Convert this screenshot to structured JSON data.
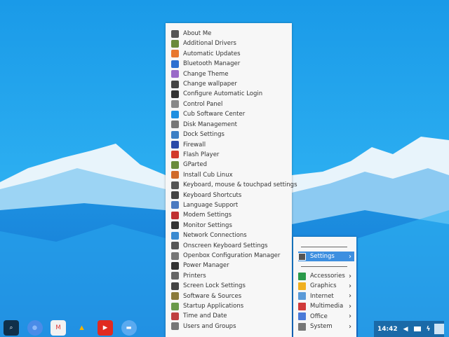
{
  "colors": {
    "accent": "#3d8fe0",
    "sky": "#2aa8f0"
  },
  "menu": {
    "items": [
      {
        "label": "About Me",
        "color": "#555"
      },
      {
        "label": "Additional Drivers",
        "color": "#6a8a3a"
      },
      {
        "label": "Automatic Updates",
        "color": "#e8772e"
      },
      {
        "label": "Bluetooth Manager",
        "color": "#2c6fd0"
      },
      {
        "label": "Change Theme",
        "color": "#9a6ac8"
      },
      {
        "label": "Change wallpaper",
        "color": "#444"
      },
      {
        "label": "Configure Automatic Login",
        "color": "#333"
      },
      {
        "label": "Control Panel",
        "color": "#888"
      },
      {
        "label": "Cub Software Center",
        "color": "#1e8ee0"
      },
      {
        "label": "Disk Management",
        "color": "#777"
      },
      {
        "label": "Dock Settings",
        "color": "#3b7fc4"
      },
      {
        "label": "Firewall",
        "color": "#2a4aa8"
      },
      {
        "label": "Flash Player",
        "color": "#d23a2a"
      },
      {
        "label": "GParted",
        "color": "#6a8a3a"
      },
      {
        "label": "Install Cub Linux",
        "color": "#d06a2a"
      },
      {
        "label": "Keyboard, mouse & touchpad settings",
        "color": "#555"
      },
      {
        "label": "Keyboard Shortcuts",
        "color": "#444"
      },
      {
        "label": "Language Support",
        "color": "#4a7ac0"
      },
      {
        "label": "Modem Settings",
        "color": "#c03030"
      },
      {
        "label": "Monitor Settings",
        "color": "#333"
      },
      {
        "label": "Network Connections",
        "color": "#3a8ad0"
      },
      {
        "label": "Onscreen Keyboard Settings",
        "color": "#555"
      },
      {
        "label": "Openbox Configuration Manager",
        "color": "#777"
      },
      {
        "label": "Power Manager",
        "color": "#333"
      },
      {
        "label": "Printers",
        "color": "#666"
      },
      {
        "label": "Screen Lock Settings",
        "color": "#444"
      },
      {
        "label": "Software & Sources",
        "color": "#8a7a3a"
      },
      {
        "label": "Startup Applications",
        "color": "#6a9a4a"
      },
      {
        "label": "Time and Date",
        "color": "#c04040"
      },
      {
        "label": "Users and Groups",
        "color": "#777"
      }
    ]
  },
  "submenu": {
    "active": {
      "label": "Settings",
      "color": "#555"
    },
    "items": [
      {
        "label": "Accessories",
        "color": "#2a9a4a"
      },
      {
        "label": "Graphics",
        "color": "#f0b020"
      },
      {
        "label": "Internet",
        "color": "#5a9ad8"
      },
      {
        "label": "Multimedia",
        "color": "#d03a3a"
      },
      {
        "label": "Office",
        "color": "#4a7ad8"
      },
      {
        "label": "System",
        "color": "#777"
      }
    ]
  },
  "dock": [
    "search",
    "chrome",
    "gmail",
    "drive",
    "youtube",
    "files"
  ],
  "tray": {
    "time": "14:42"
  }
}
